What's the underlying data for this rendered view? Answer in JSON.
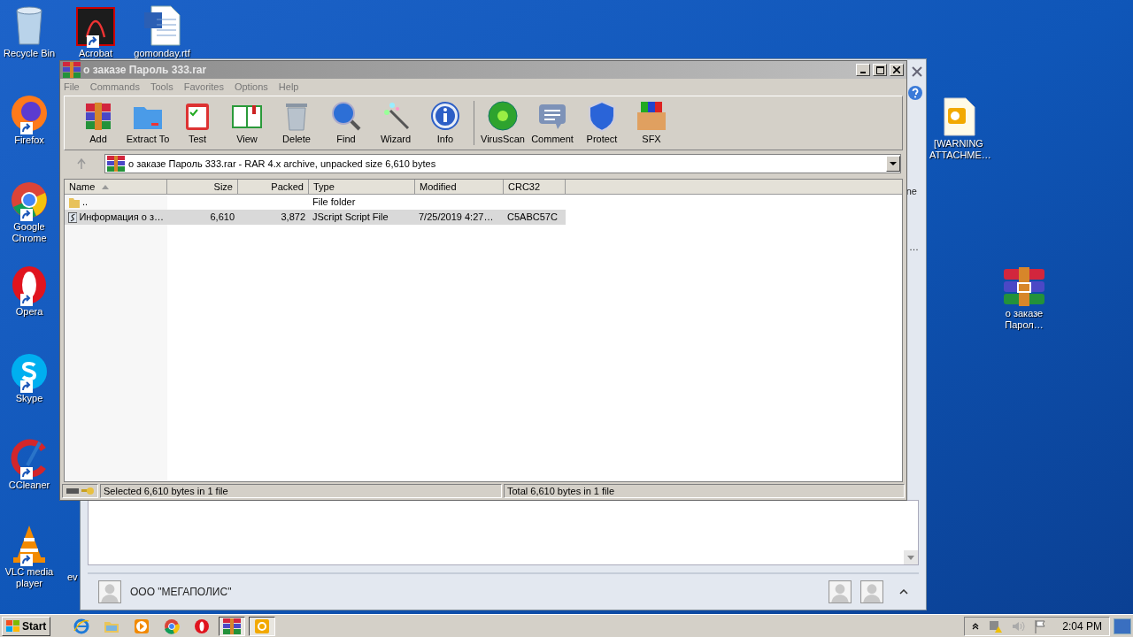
{
  "desktop_icons": [
    {
      "label": "Recycle Bin",
      "kind": "bin"
    },
    {
      "label": "Acrobat",
      "kind": "pdf"
    },
    {
      "label": "gomonday.rtf",
      "kind": "doc"
    },
    {
      "label": "Firefox",
      "kind": "firefox"
    },
    {
      "label": "Google Chrome",
      "kind": "chrome"
    },
    {
      "label": "Opera",
      "kind": "opera"
    },
    {
      "label": "Skype",
      "kind": "skype"
    },
    {
      "label": "CCleaner",
      "kind": "ccleaner"
    },
    {
      "label": "VLC media player",
      "kind": "vlc"
    },
    {
      "label": "ev",
      "kind": "none"
    },
    {
      "label": "[WARNING ATTACHME…",
      "kind": "outlook"
    },
    {
      "label": "о заказе Парол…",
      "kind": "rar"
    }
  ],
  "mail_window": {
    "fragments": [
      "ne",
      "…"
    ],
    "sender": "ООО \"МЕГАПОЛИС\""
  },
  "window": {
    "title": "о заказе Пароль 333.rar",
    "menu": [
      "File",
      "Commands",
      "Tools",
      "Favorites",
      "Options",
      "Help"
    ],
    "toolbar": [
      {
        "label": "Add",
        "kind": "archive"
      },
      {
        "label": "Extract To",
        "kind": "folder"
      },
      {
        "label": "Test",
        "kind": "clipboard"
      },
      {
        "label": "View",
        "kind": "book"
      },
      {
        "label": "Delete",
        "kind": "trash"
      },
      {
        "label": "Find",
        "kind": "magnifier"
      },
      {
        "label": "Wizard",
        "kind": "wand"
      },
      {
        "label": "Info",
        "kind": "info"
      },
      {
        "label": "VirusScan",
        "kind": "bug"
      },
      {
        "label": "Comment",
        "kind": "speech"
      },
      {
        "label": "Protect",
        "kind": "shield"
      },
      {
        "label": "SFX",
        "kind": "box"
      }
    ],
    "address": "о заказе Пароль 333.rar - RAR 4.x archive, unpacked size 6,610 bytes",
    "columns": [
      {
        "label": "Name",
        "sorted": true
      },
      {
        "label": "Size",
        "sorted": false
      },
      {
        "label": "Packed",
        "sorted": false
      },
      {
        "label": "Type",
        "sorted": false
      },
      {
        "label": "Modified",
        "sorted": false
      },
      {
        "label": "CRC32",
        "sorted": false
      }
    ],
    "rows": [
      {
        "kind": "folder",
        "name": "..",
        "size": "",
        "packed": "",
        "type": "File folder",
        "modified": "",
        "crc32": "",
        "selected": false
      },
      {
        "kind": "script",
        "name": "Информация о з…",
        "size": "6,610",
        "packed": "3,872",
        "type": "JScript Script File",
        "modified": "7/25/2019 4:27…",
        "crc32": "C5ABC57C",
        "selected": true
      }
    ],
    "status_left": "Selected 6,610 bytes in 1 file",
    "status_right": "Total 6,610 bytes in 1 file"
  },
  "taskbar": {
    "start": "Start",
    "apps": [
      {
        "kind": "ie",
        "active": false
      },
      {
        "kind": "explorer",
        "active": false
      },
      {
        "kind": "media",
        "active": false
      },
      {
        "kind": "chrome",
        "active": false
      },
      {
        "kind": "opera",
        "active": false
      },
      {
        "kind": "rar",
        "active": true
      },
      {
        "kind": "outlook",
        "active": true
      }
    ],
    "clock": "2:04 PM"
  }
}
